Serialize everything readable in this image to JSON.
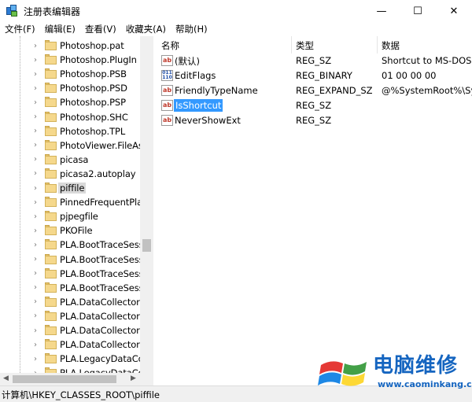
{
  "window": {
    "title": "注册表编辑器",
    "minimize": "—",
    "maximize": "☐",
    "close": "✕"
  },
  "menu": [
    "文件(F)",
    "编辑(E)",
    "查看(V)",
    "收藏夹(A)",
    "帮助(H)"
  ],
  "tree": {
    "items": [
      {
        "label": "Photoshop.pat"
      },
      {
        "label": "Photoshop.PlugIn"
      },
      {
        "label": "Photoshop.PSB"
      },
      {
        "label": "Photoshop.PSD"
      },
      {
        "label": "Photoshop.PSP"
      },
      {
        "label": "Photoshop.SHC"
      },
      {
        "label": "Photoshop.TPL"
      },
      {
        "label": "PhotoViewer.FileAss"
      },
      {
        "label": "picasa"
      },
      {
        "label": "picasa2.autoplay"
      },
      {
        "label": "piffile",
        "selected": true
      },
      {
        "label": "PinnedFrequentPlac"
      },
      {
        "label": "pjpegfile"
      },
      {
        "label": "PKOFile"
      },
      {
        "label": "PLA.BootTraceSessi"
      },
      {
        "label": "PLA.BootTraceSessi"
      },
      {
        "label": "PLA.BootTraceSessi"
      },
      {
        "label": "PLA.BootTraceSessi"
      },
      {
        "label": "PLA.DataCollectorSe"
      },
      {
        "label": "PLA.DataCollectorSe"
      },
      {
        "label": "PLA.DataCollectorSe"
      },
      {
        "label": "PLA.DataCollectorSe"
      },
      {
        "label": "PLA.LegacyDataColl"
      },
      {
        "label": "PLA.LegacyDataColl"
      }
    ]
  },
  "values": {
    "headers": {
      "name": "名称",
      "type": "类型",
      "data": "数据"
    },
    "rows": [
      {
        "icon": "ab",
        "name": "(默认)",
        "type": "REG_SZ",
        "data": "Shortcut to MS-DOS P"
      },
      {
        "icon": "bin",
        "name": "EditFlags",
        "type": "REG_BINARY",
        "data": "01 00 00 00"
      },
      {
        "icon": "ab",
        "name": "FriendlyTypeName",
        "type": "REG_EXPAND_SZ",
        "data": "@%SystemRoot%\\Sys"
      },
      {
        "icon": "ab",
        "name": "IsShortcut",
        "type": "REG_SZ",
        "data": "",
        "selected": true
      },
      {
        "icon": "ab",
        "name": "NeverShowExt",
        "type": "REG_SZ",
        "data": ""
      }
    ]
  },
  "status": {
    "path": "计算机\\HKEY_CLASSES_ROOT\\piffile"
  },
  "watermark": {
    "title": "电脑维修",
    "url": "www.caominkang.com"
  },
  "colors": {
    "selection": "#3399ff",
    "watermark": "#1565c0"
  }
}
